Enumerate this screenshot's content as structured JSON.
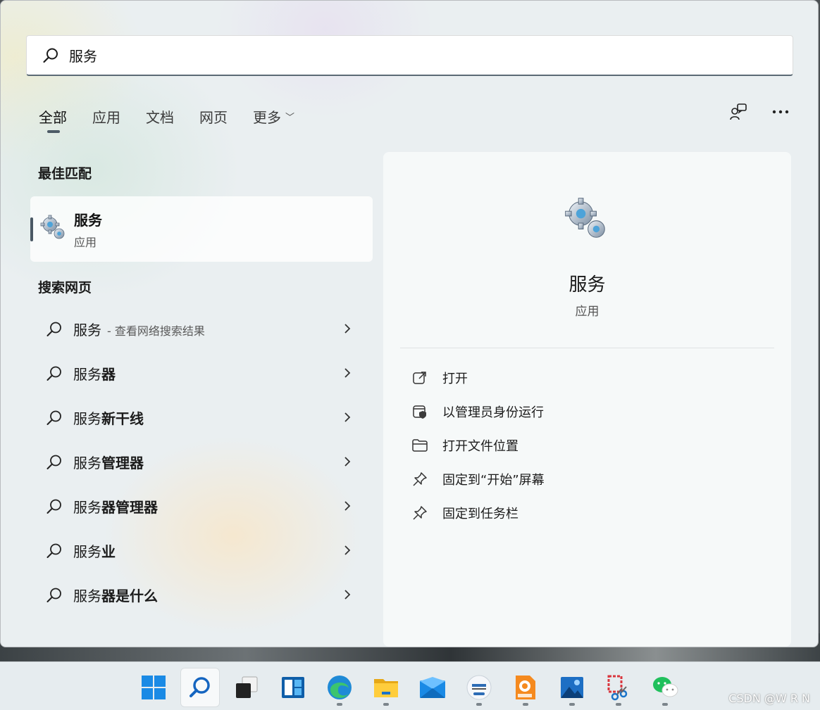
{
  "search": {
    "value": "服务",
    "icon": "search-icon"
  },
  "tabs": [
    {
      "label": "全部",
      "active": true
    },
    {
      "label": "应用"
    },
    {
      "label": "文档"
    },
    {
      "label": "网页"
    },
    {
      "label": "更多"
    }
  ],
  "top_icons": [
    "feedback-icon",
    "more-options-icon"
  ],
  "best_match": {
    "heading": "最佳匹配",
    "name": "服务",
    "type": "应用",
    "icon": "services-gear-icon"
  },
  "web_search": {
    "heading": "搜索网页",
    "items": [
      {
        "prefix": "服务",
        "suffix": "",
        "sub": "- 查看网络搜索结果"
      },
      {
        "prefix": "服务",
        "suffix": "器",
        "sub": ""
      },
      {
        "prefix": "服务",
        "suffix": "新干线",
        "sub": ""
      },
      {
        "prefix": "服务",
        "suffix": "管理器",
        "sub": ""
      },
      {
        "prefix": "服务",
        "suffix": "器管理器",
        "sub": ""
      },
      {
        "prefix": "服务",
        "suffix": "业",
        "sub": ""
      },
      {
        "prefix": "服务",
        "suffix": "器是什么",
        "sub": ""
      }
    ]
  },
  "detail": {
    "name": "服务",
    "type": "应用",
    "actions": [
      {
        "label": "打开",
        "icon": "open-external-icon"
      },
      {
        "label": "以管理员身份运行",
        "icon": "run-as-admin-icon"
      },
      {
        "label": "打开文件位置",
        "icon": "folder-icon"
      },
      {
        "label": "固定到“开始”屏幕",
        "icon": "pin-icon"
      },
      {
        "label": "固定到任务栏",
        "icon": "pin-icon"
      }
    ]
  },
  "taskbar": {
    "items": [
      "start-icon",
      "search-icon",
      "task-view-icon",
      "widgets-icon",
      "edge-icon",
      "file-explorer-icon",
      "mail-icon",
      "school-app-icon",
      "pdf-reader-icon",
      "photos-icon",
      "snipping-tool-icon",
      "wechat-icon"
    ]
  },
  "watermark": "CSDN @W R N"
}
